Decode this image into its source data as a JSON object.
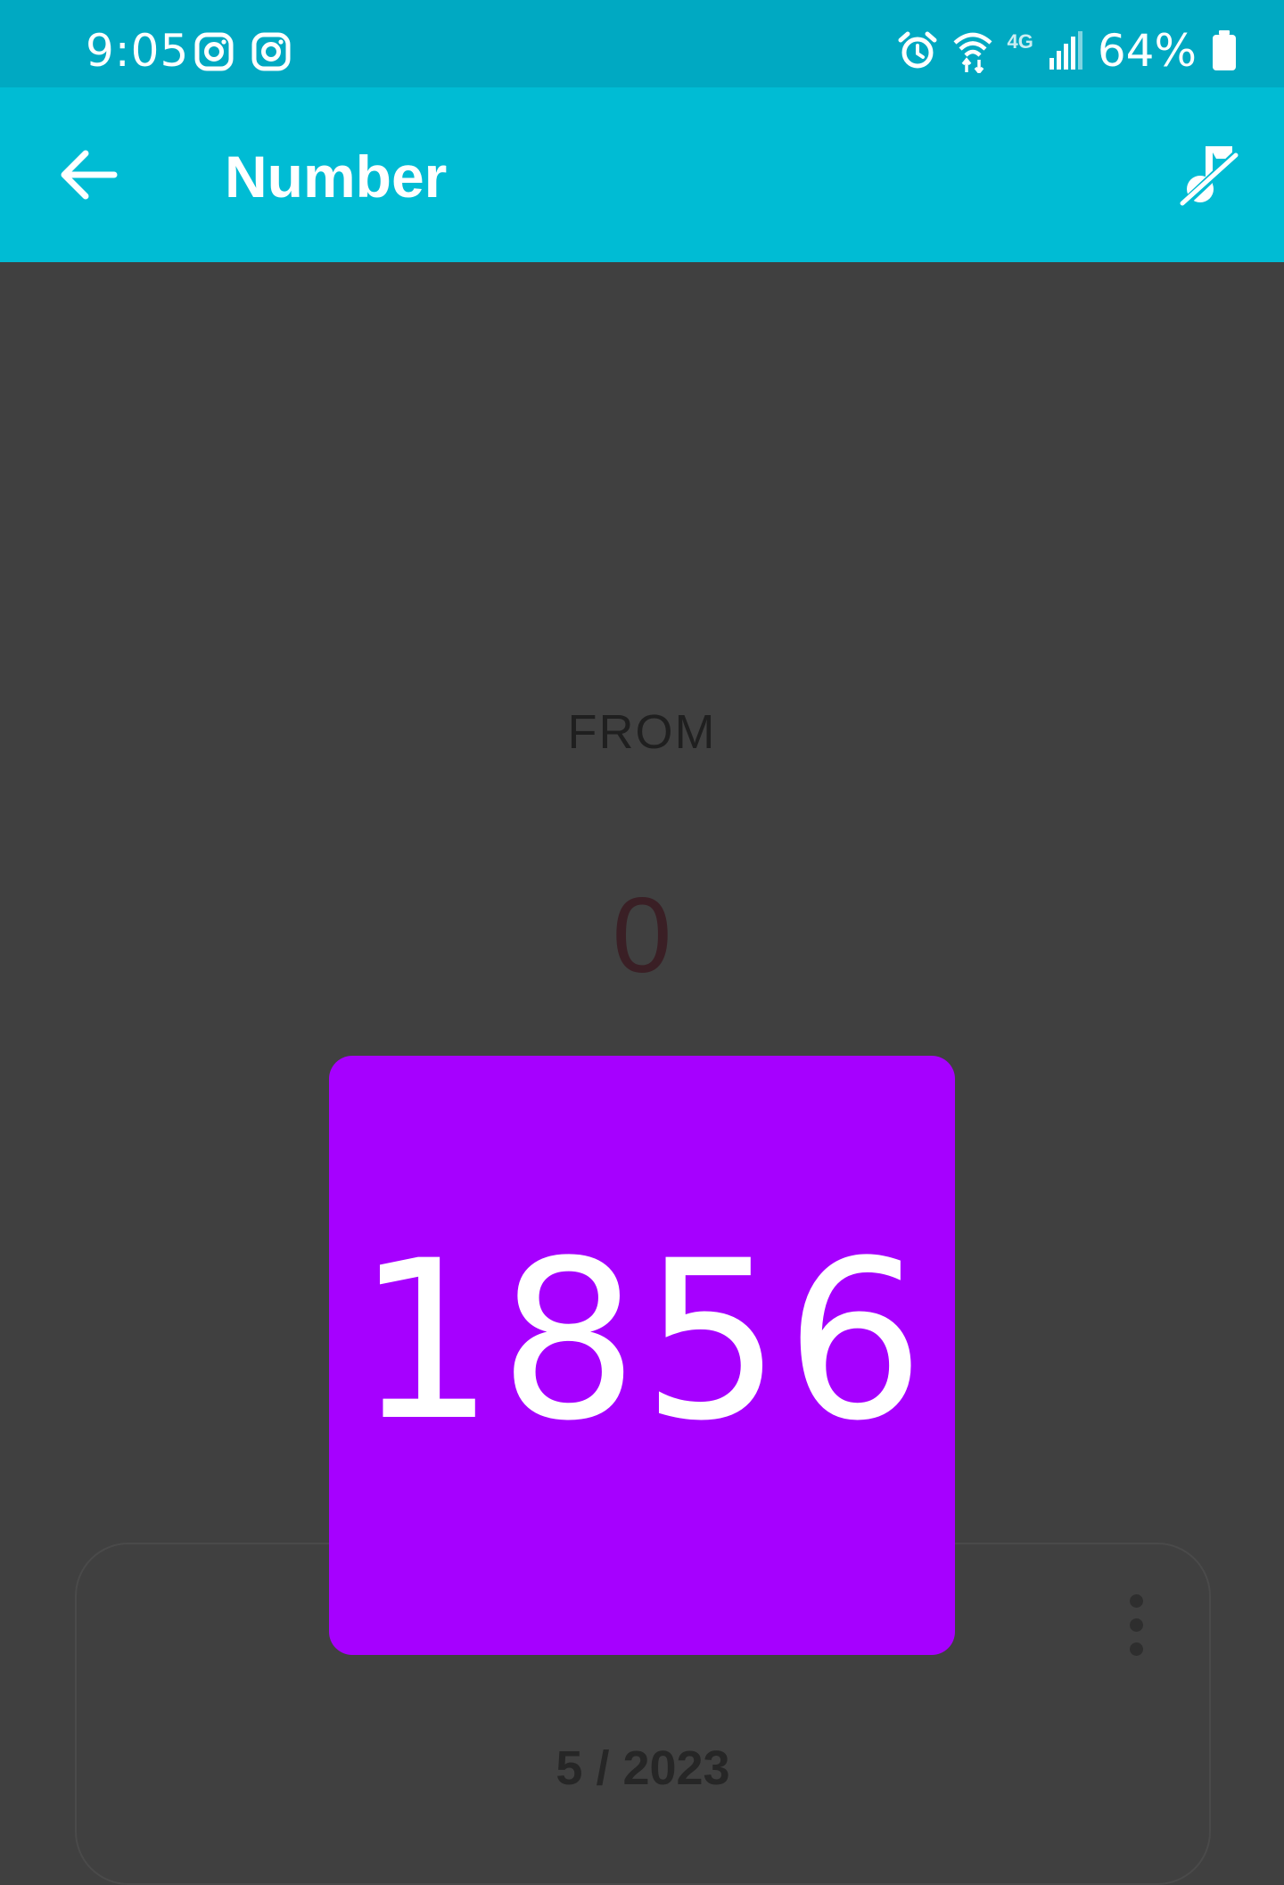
{
  "status_bar": {
    "time": "9:05",
    "battery": "64%",
    "network": "4G",
    "icons": [
      "instagram-icon",
      "instagram-icon",
      "alarm-icon",
      "wifi-icon",
      "signal-icon",
      "battery-icon"
    ]
  },
  "app_bar": {
    "title": "Number",
    "back_icon": "arrow-left-icon",
    "action_icon": "music-off-icon"
  },
  "main": {
    "from_label": "FROM",
    "from_value": "0",
    "number": "1856",
    "date": "5 / 2023"
  },
  "colors": {
    "status_bar": "#00a9c2",
    "app_bar": "#00bcd4",
    "background": "#404040",
    "number_tile": "#a600ff"
  }
}
